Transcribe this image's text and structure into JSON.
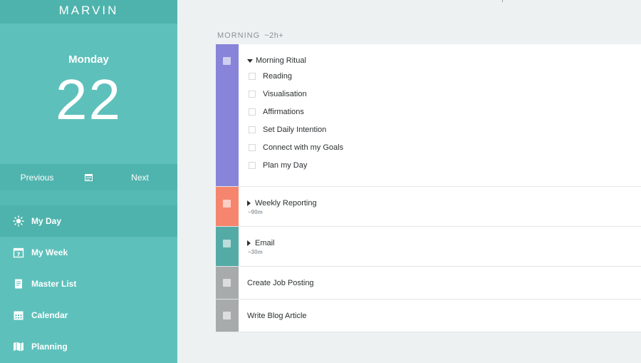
{
  "app": {
    "brand": "MARVIN"
  },
  "date": {
    "weekday": "Monday",
    "day": "22"
  },
  "nav": {
    "previous": "Previous",
    "next": "Next"
  },
  "menu": [
    {
      "label": "My Day",
      "icon": "sun-icon",
      "active": true
    },
    {
      "label": "My Week",
      "icon": "calendar-week-icon"
    },
    {
      "label": "Master List",
      "icon": "scroll-icon"
    },
    {
      "label": "Calendar",
      "icon": "calendar-icon"
    },
    {
      "label": "Planning",
      "icon": "map-icon"
    }
  ],
  "section": {
    "title": "MORNING",
    "estimate": "~2h+"
  },
  "tasks": [
    {
      "title": "Morning Ritual",
      "color": "#8784d9",
      "expanded": true,
      "subtasks": [
        "Reading",
        "Visualisation",
        "Affirmations",
        "Set Daily Intention",
        "Connect with my Goals",
        "Plan my Day"
      ]
    },
    {
      "title": "Weekly Reporting",
      "estimate": "~90m",
      "color": "#f5866d",
      "expanded": false
    },
    {
      "title": "Email",
      "estimate": "~30m",
      "color": "#54aba6",
      "expanded": false
    },
    {
      "title": "Create Job Posting",
      "color": "#a8abac"
    },
    {
      "title": "Write Blog Article",
      "color": "#a8abac"
    }
  ]
}
